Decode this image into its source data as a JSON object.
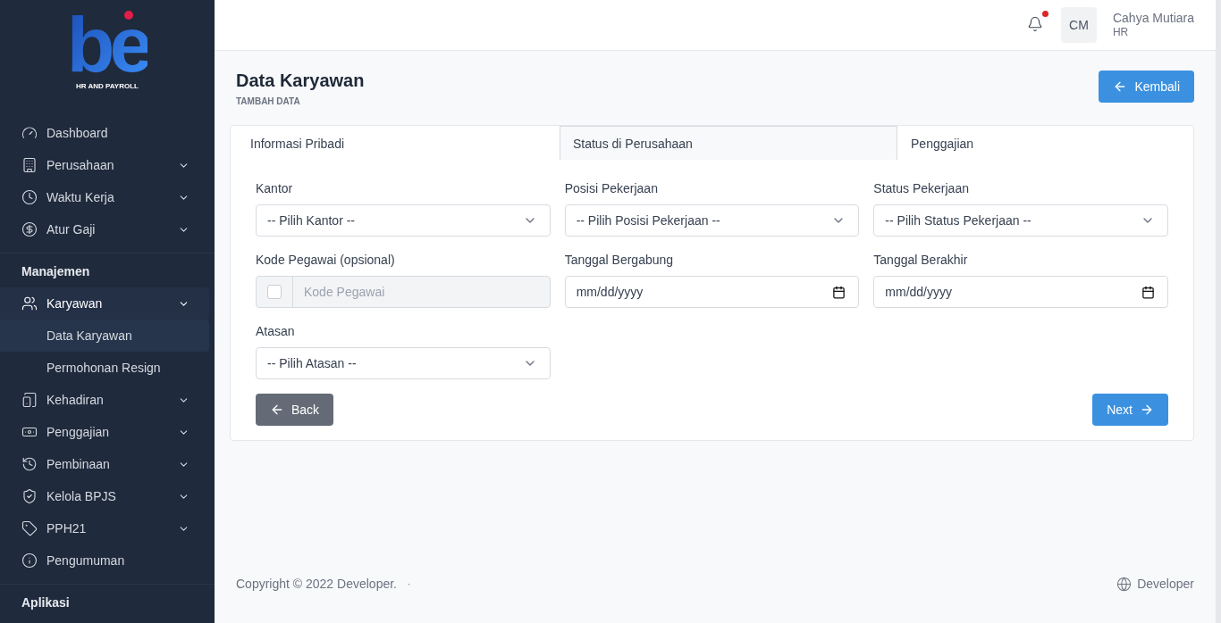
{
  "logo": {
    "mark": "be",
    "tagline": "HR AND PAYROLL"
  },
  "sidebar": {
    "groups": [
      {
        "items": [
          {
            "kind": "link",
            "label": "Dashboard",
            "selected": false
          },
          {
            "kind": "group",
            "label": "Perusahaan",
            "selected": false
          },
          {
            "kind": "group",
            "label": "Waktu Kerja",
            "selected": false
          },
          {
            "kind": "group",
            "label": "Atur Gaji",
            "selected": false
          }
        ]
      },
      {
        "heading": "Manajemen",
        "items": [
          {
            "kind": "group",
            "label": "Karyawan",
            "selected": true,
            "children": [
              {
                "label": "Data Karyawan",
                "selected": true
              },
              {
                "label": "Permohonan Resign",
                "selected": false
              }
            ]
          },
          {
            "kind": "group",
            "label": "Kehadiran",
            "selected": false
          },
          {
            "kind": "group",
            "label": "Penggajian",
            "selected": false
          },
          {
            "kind": "group",
            "label": "Pembinaan",
            "selected": false
          },
          {
            "kind": "group",
            "label": "Kelola BPJS",
            "selected": false
          },
          {
            "kind": "group",
            "label": "PPH21",
            "selected": false
          },
          {
            "kind": "link",
            "label": "Pengumuman",
            "selected": false
          }
        ]
      },
      {
        "heading": "Aplikasi"
      }
    ]
  },
  "topbar": {
    "notification": true,
    "user": {
      "initials": "CM",
      "name": "Cahya Mutiara",
      "role": "HR"
    }
  },
  "page": {
    "title": "Data Karyawan",
    "subtitle": "TAMBAH DATA",
    "back_button": "Kembali"
  },
  "tabs": [
    {
      "label": "Informasi Pribadi",
      "selected": false
    },
    {
      "label": "Status di Perusahaan",
      "selected": true
    },
    {
      "label": "Penggajian",
      "selected": false
    }
  ],
  "fields": [
    {
      "kind": "select",
      "label": "Kantor",
      "placeholder": "-- Pilih Kantor --"
    },
    {
      "kind": "select",
      "label": "Posisi Pekerjaan",
      "placeholder": "-- Pilih Posisi Pekerjaan --"
    },
    {
      "kind": "select",
      "label": "Status Pekerjaan",
      "placeholder": "-- Pilih Status Pekerjaan --"
    },
    {
      "kind": "check-input",
      "label": "Kode Pegawai (opsional)",
      "placeholder": "Kode Pegawai",
      "checked": false
    },
    {
      "kind": "date",
      "label": "Tanggal Bergabung",
      "placeholder": "mm/dd/yyyy"
    },
    {
      "kind": "date",
      "label": "Tanggal Berakhir",
      "placeholder": "mm/dd/yyyy"
    },
    {
      "kind": "select",
      "label": "Atasan",
      "placeholder": "-- Pilih Atasan --"
    }
  ],
  "actions": {
    "back": "Back",
    "next": "Next"
  },
  "footer": {
    "copyright": "Copyright © 2022 Developer.",
    "separator": "·",
    "link": "Developer"
  }
}
